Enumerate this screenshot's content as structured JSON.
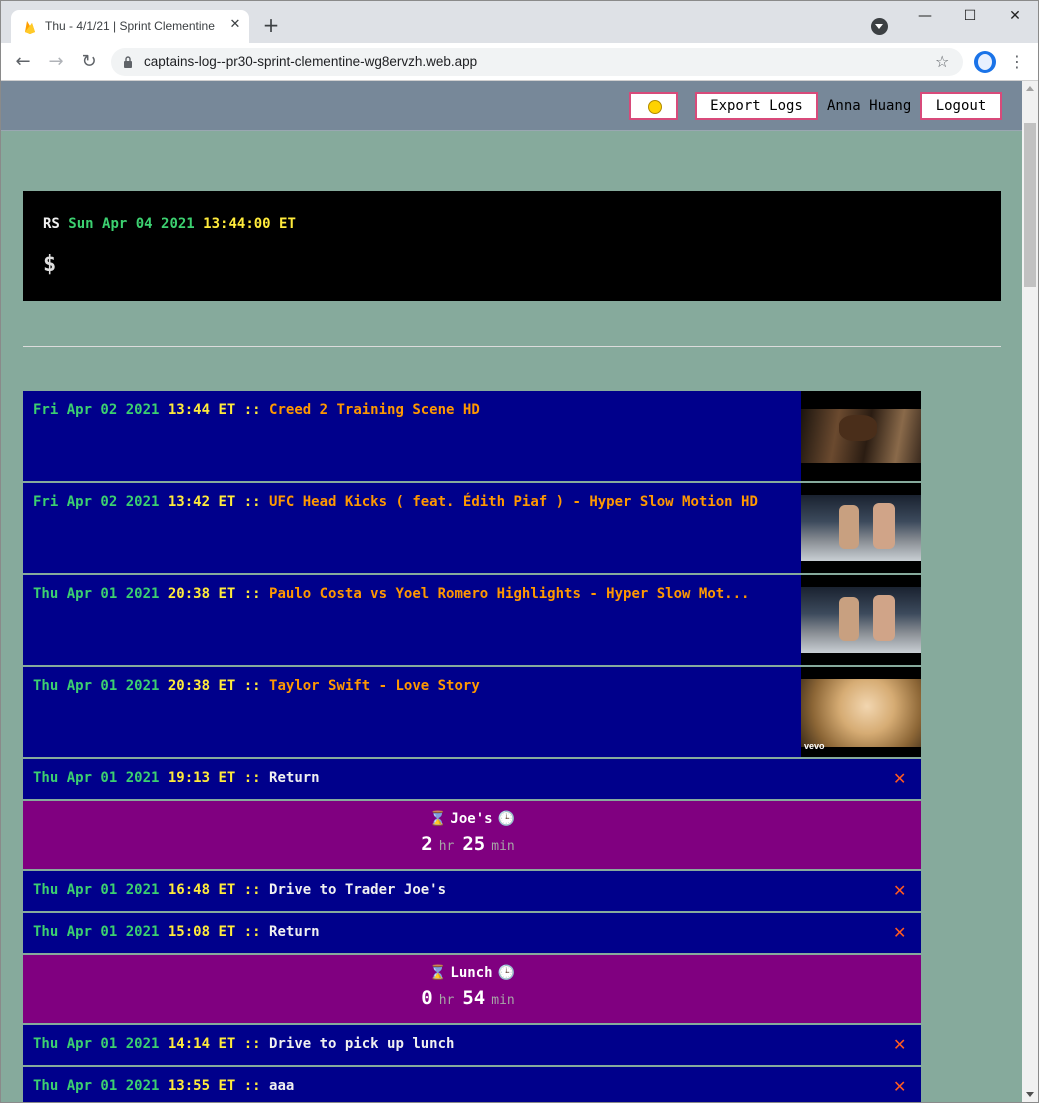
{
  "browser": {
    "tab_title": "Thu - 4/1/21 | Sprint Clementine",
    "url": "captains-log--pr30-sprint-clementine-wg8ervzh.web.app"
  },
  "nav": {
    "theme_icon": "sun-icon",
    "export_label": "Export Logs",
    "user_name": "Anna Huang",
    "logout_label": "Logout"
  },
  "terminal": {
    "prefix": "RS",
    "date": "Sun Apr 04 2021",
    "time": "13:44:00",
    "tz": "ET",
    "prompt": "$"
  },
  "logs": [
    {
      "kind": "media",
      "date": "Fri Apr 02 2021",
      "time": "13:44",
      "tz": "ET",
      "sep": "::",
      "title": "Creed 2 Training Scene HD",
      "thumb": "boxing-thumbnail"
    },
    {
      "kind": "media",
      "date": "Fri Apr 02 2021",
      "time": "13:42",
      "tz": "ET",
      "sep": "::",
      "title": "UFC Head Kicks ( feat. Édith Piaf ) - Hyper Slow Motion HD",
      "thumb": "ufc-thumbnail"
    },
    {
      "kind": "media",
      "date": "Thu Apr 01 2021",
      "time": "20:38",
      "tz": "ET",
      "sep": "::",
      "title": "Paulo Costa vs Yoel Romero Highlights - Hyper Slow Mot...",
      "thumb": "ufc-thumbnail"
    },
    {
      "kind": "media",
      "date": "Thu Apr 01 2021",
      "time": "20:38",
      "tz": "ET",
      "sep": "::",
      "title": "Taylor Swift - Love Story",
      "thumb": "music-video-thumbnail",
      "thumb_badge": "vevo"
    },
    {
      "kind": "entry",
      "date": "Thu Apr 01 2021",
      "time": "19:13",
      "tz": "ET",
      "sep": "::",
      "title": "Return"
    },
    {
      "kind": "duration",
      "label": "Joe's",
      "hours": "2",
      "hr": "hr",
      "minutes": "25",
      "min": "min"
    },
    {
      "kind": "entry",
      "date": "Thu Apr 01 2021",
      "time": "16:48",
      "tz": "ET",
      "sep": "::",
      "title": "Drive to Trader Joe's"
    },
    {
      "kind": "entry",
      "date": "Thu Apr 01 2021",
      "time": "15:08",
      "tz": "ET",
      "sep": "::",
      "title": "Return"
    },
    {
      "kind": "duration",
      "label": "Lunch",
      "hours": "0",
      "hr": "hr",
      "minutes": "54",
      "min": "min"
    },
    {
      "kind": "entry",
      "date": "Thu Apr 01 2021",
      "time": "14:14",
      "tz": "ET",
      "sep": "::",
      "title": "Drive to pick up lunch"
    },
    {
      "kind": "entry",
      "date": "Thu Apr 01 2021",
      "time": "13:55",
      "tz": "ET",
      "sep": "::",
      "title": "aaa"
    }
  ],
  "colors": {
    "page_bg": "#86aa9c",
    "nav_bg": "#778899",
    "row_bg": "#00008b",
    "duration_bg": "#800080",
    "date": "#3cd070",
    "time": "#ffeb3b",
    "title": "#ff9800",
    "delete": "#ff5a1f",
    "button_border": "#d84a7a"
  }
}
